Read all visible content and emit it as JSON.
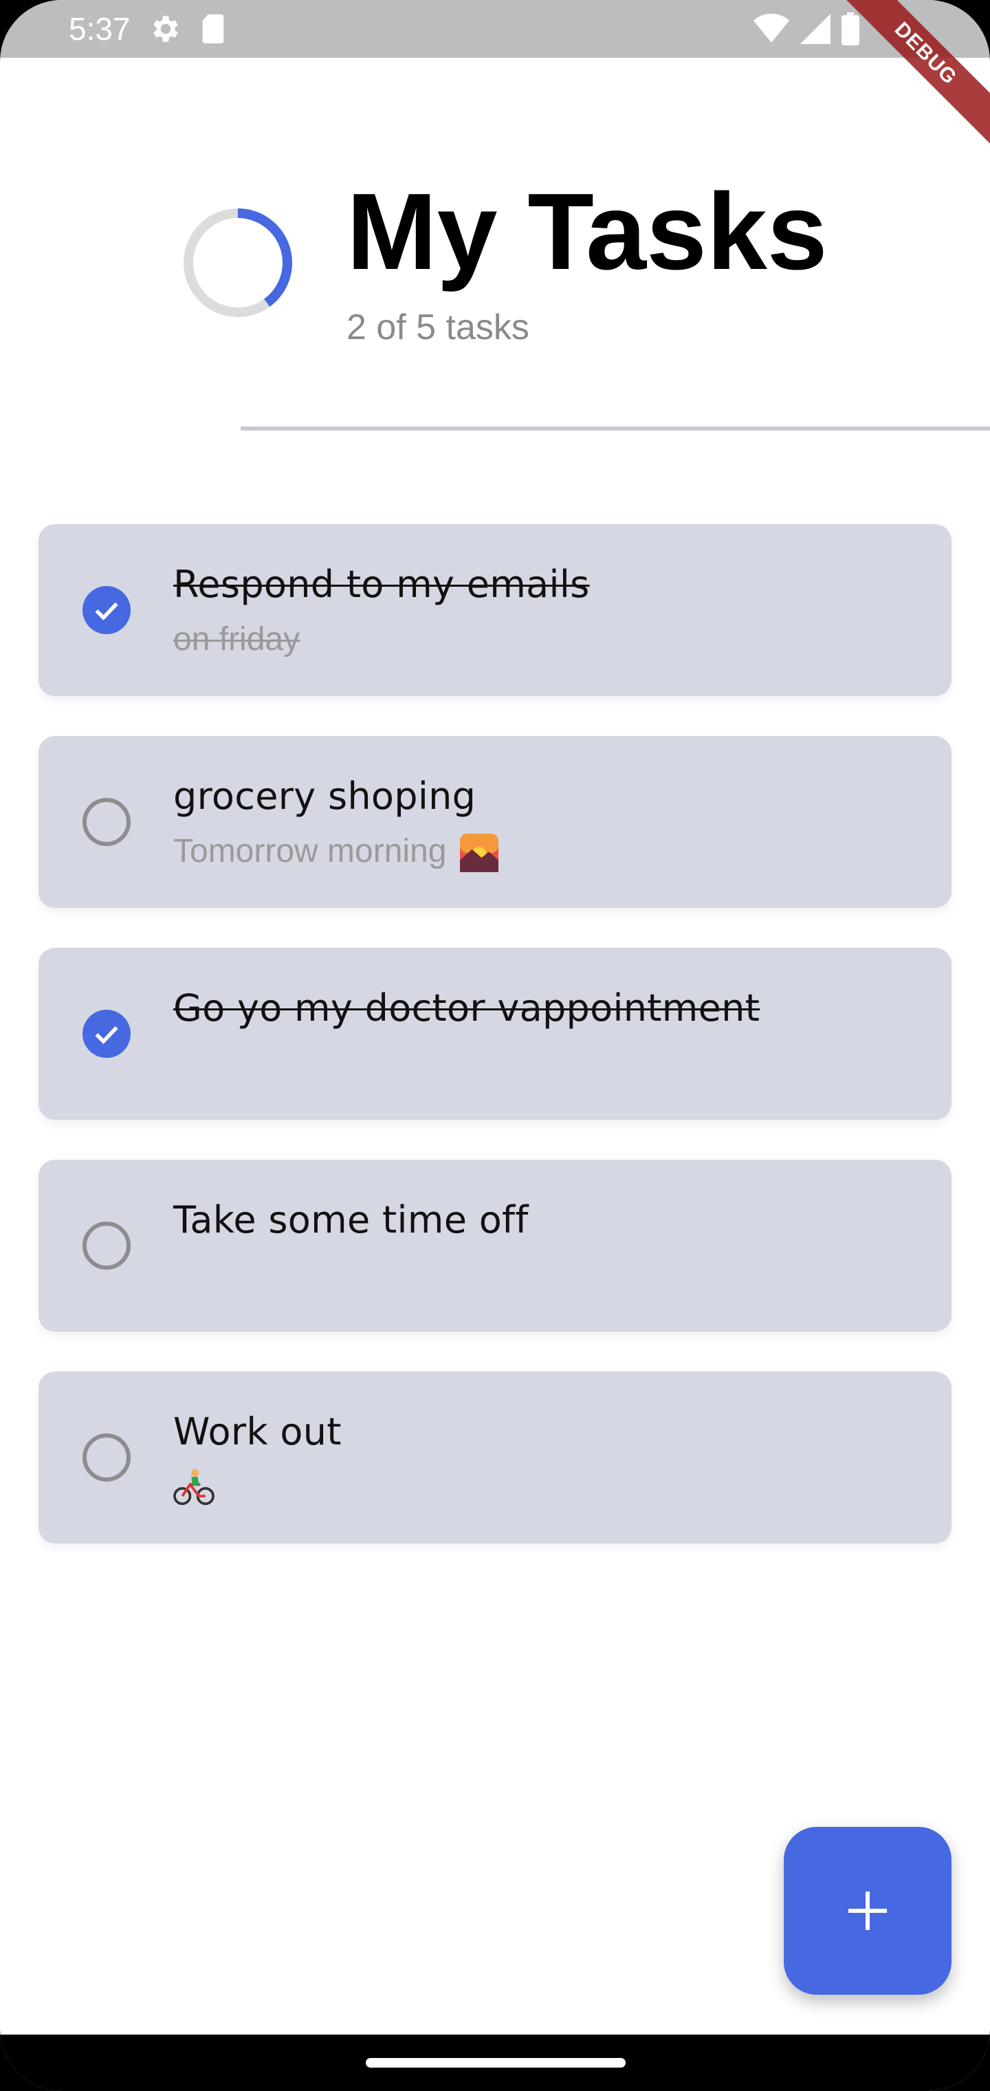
{
  "status_bar": {
    "time": "5:37",
    "icons_left": [
      "gear-icon",
      "sd-card-icon"
    ],
    "icons_right": [
      "wifi-icon",
      "signal-icon",
      "battery-icon"
    ]
  },
  "debug_banner": "DEBUG",
  "header": {
    "title": "My Tasks",
    "subtitle": "2 of 5 tasks",
    "progress_fraction": 0.4,
    "progress_color": "#4668e0",
    "track_color": "#dcdcdc"
  },
  "tasks": [
    {
      "title": "Respond to my emails",
      "note": "on friday",
      "done": true
    },
    {
      "title": "grocery shoping",
      "note": "Tomorrow morning",
      "note_emoji": "sunrise-over-mountains-emoji",
      "done": false
    },
    {
      "title": "Go yo my doctor vappointment",
      "note": "",
      "done": true
    },
    {
      "title": "Take some time off",
      "note": "",
      "done": false
    },
    {
      "title": "Work out",
      "note": "",
      "note_emoji": "person-biking-emoji",
      "done": false
    }
  ],
  "fab": {
    "icon": "plus-icon",
    "color": "#4668e0"
  },
  "colors": {
    "card_bg": "#d5d8e3",
    "accent": "#4668e0"
  }
}
